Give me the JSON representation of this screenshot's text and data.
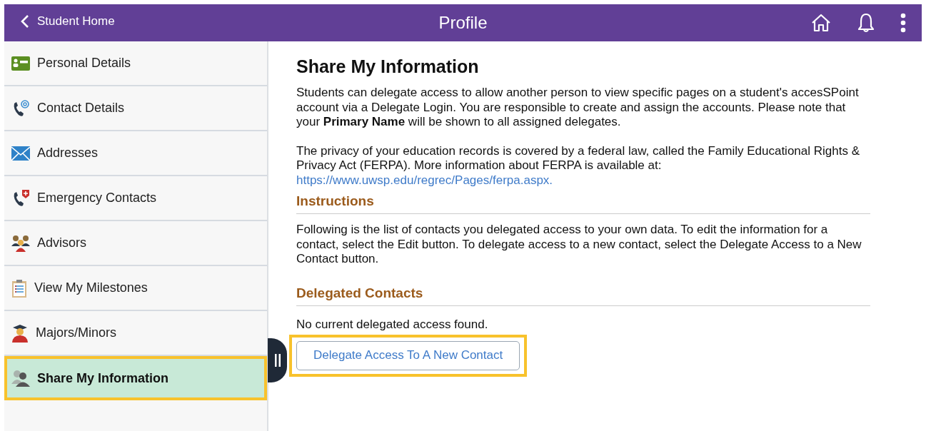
{
  "header": {
    "back": "Student Home",
    "title": "Profile"
  },
  "sidebar": {
    "items": [
      {
        "label": "Personal Details",
        "selected": false
      },
      {
        "label": "Contact Details",
        "selected": false
      },
      {
        "label": "Addresses",
        "selected": false
      },
      {
        "label": "Emergency Contacts",
        "selected": false
      },
      {
        "label": "Advisors",
        "selected": false
      },
      {
        "label": "View My Milestones",
        "selected": false
      },
      {
        "label": "Majors/Minors",
        "selected": false
      },
      {
        "label": "Share My Information",
        "selected": true
      }
    ]
  },
  "content": {
    "title": "Share My Information",
    "intro": "Students can delegate access to allow another person to view specific pages on a student's accesSPoint account via a Delegate Login. You are responsible to create and assign the accounts. Please note that your **Primary Name** will be shown to all assigned delegates.",
    "privacy": "The privacy of your education records is covered by a federal law, called the Family Educational Rights & Privacy Act (FERPA). More information about FERPA is available at:",
    "link": "https://www.uwsp.edu/regrec/Pages/ferpa.aspx.",
    "sections": [
      {
        "heading": "Instructions",
        "text": "Following is the list of contacts you delegated access to your own data. To edit the information for a contact, select the Edit button. To delegate access to a new contact, select the Delegate Access to a New Contact button."
      },
      {
        "heading": "Delegated Contacts",
        "text": "No current delegated access found."
      }
    ],
    "button": {
      "label": "Delegate Access To A New Contact",
      "highlighted": true
    }
  }
}
